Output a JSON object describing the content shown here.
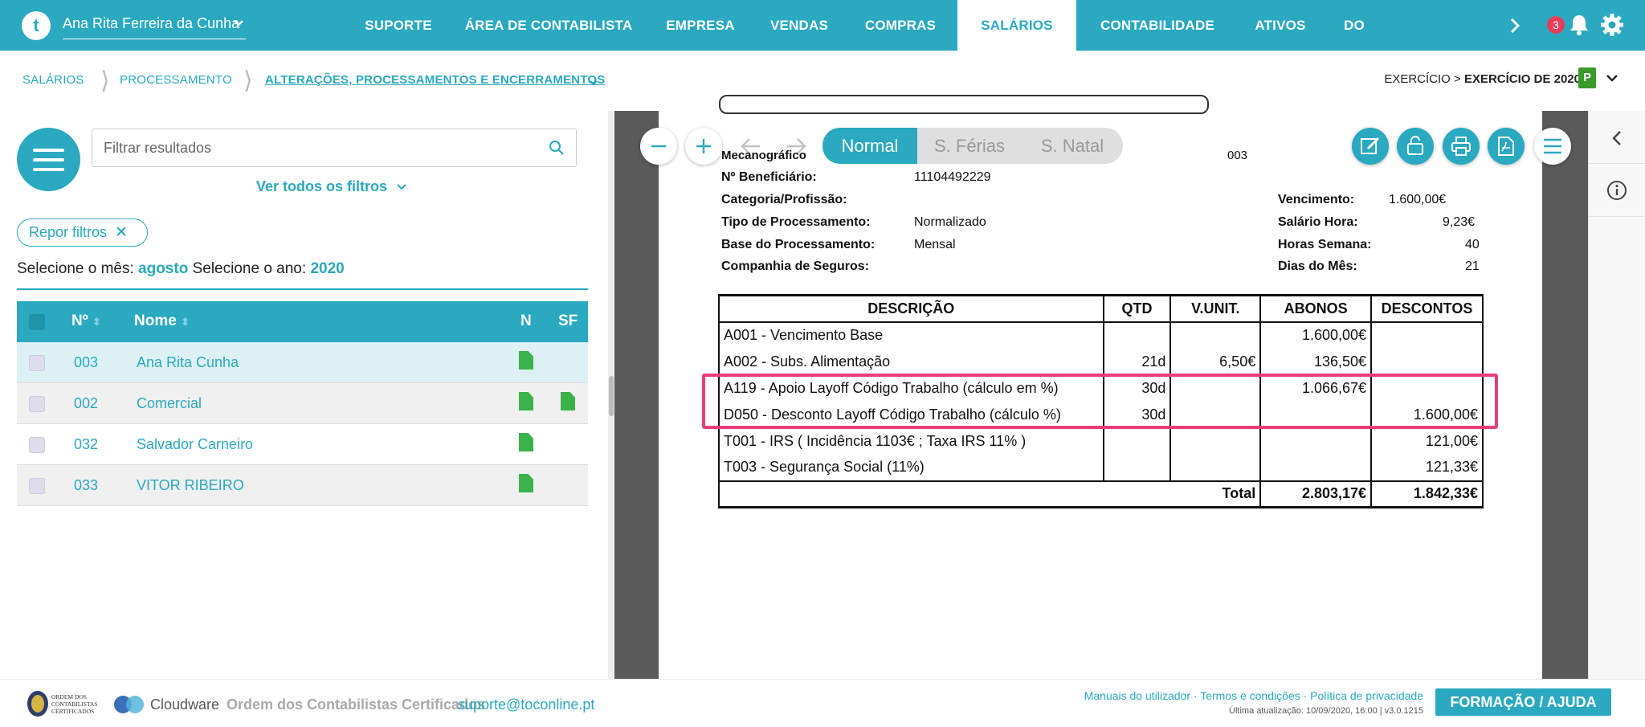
{
  "header": {
    "logo_letter": "t",
    "user_name": "Ana Rita Ferreira da Cunha",
    "nav": [
      "SUPORTE",
      "ÁREA DE CONTABILISTA",
      "EMPRESA",
      "VENDAS",
      "COMPRAS",
      "SALÁRIOS",
      "CONTABILIDADE",
      "ATIVOS",
      "DO"
    ],
    "active_nav": "SALÁRIOS",
    "notifications_count": "3"
  },
  "breadcrumb": {
    "items": [
      "SALÁRIOS",
      "PROCESSAMENTO",
      "ALTERAÇÕES, PROCESSAMENTOS E ENCERRAMENTOS"
    ],
    "exercise_prefix": "EXERCÍCIO >",
    "exercise_value": "EXERCÍCIO DE 2020",
    "exercise_badge": "P"
  },
  "left": {
    "filter_placeholder": "Filtrar resultados",
    "all_filters": "Ver todos os filtros",
    "reset_filters": "Repor filtros",
    "month_label": "Selecione o mês:",
    "month_value": "agosto",
    "year_label": "Selecione o ano:",
    "year_value": "2020",
    "columns": {
      "num": "Nº",
      "name": "Nome",
      "n": "N",
      "sf": "SF"
    },
    "rows": [
      {
        "num": "003",
        "name": "Ana Rita Cunha",
        "n": true,
        "sf": false
      },
      {
        "num": "002",
        "name": "Comercial",
        "n": true,
        "sf": true
      },
      {
        "num": "032",
        "name": "Salvador Carneiro",
        "n": true,
        "sf": false
      },
      {
        "num": "033",
        "name": "VITOR RIBEIRO",
        "n": true,
        "sf": false
      }
    ]
  },
  "viewer": {
    "tabs": [
      "Normal",
      "S. Férias",
      "S. Natal"
    ],
    "active_tab": "Normal",
    "info": {
      "mecanografico_label": "Mecanográfico",
      "mecanografico_value": "003",
      "beneficiario_label": "Nº Beneficiário:",
      "beneficiario_value": "11104492229",
      "categoria_label": "Categoria/Profissão:",
      "tipo_label": "Tipo de Processamento:",
      "tipo_value": "Normalizado",
      "base_label": "Base do Processamento:",
      "base_value": "Mensal",
      "seguros_label": "Companhia de Seguros:",
      "vencimento_label": "Vencimento:",
      "vencimento_value": "1.600,00€",
      "salario_hora_label": "Salário Hora:",
      "salario_hora_value": "9,23€",
      "horas_semana_label": "Horas Semana:",
      "horas_semana_value": "40",
      "dias_mes_label": "Dias do Mês:",
      "dias_mes_value": "21"
    },
    "table": {
      "headers": [
        "DESCRIÇÃO",
        "QTD",
        "V.UNIT.",
        "ABONOS",
        "DESCONTOS"
      ],
      "rows": [
        {
          "desc": "A001 - Vencimento Base",
          "qtd": "",
          "unit": "",
          "abonos": "1.600,00€",
          "descontos": ""
        },
        {
          "desc": "A002 - Subs. Alimentação",
          "qtd": "21d",
          "unit": "6,50€",
          "abonos": "136,50€",
          "descontos": ""
        },
        {
          "desc": "A119 - Apoio Layoff Código Trabalho (cálculo em %)",
          "qtd": "30d",
          "unit": "",
          "abonos": "1.066,67€",
          "descontos": ""
        },
        {
          "desc": "D050 - Desconto Layoff Código Trabalho (cálculo %)",
          "qtd": "30d",
          "unit": "",
          "abonos": "",
          "descontos": "1.600,00€"
        },
        {
          "desc": "T001 - IRS ( Incidência 1103€ ; Taxa IRS 11% )",
          "qtd": "",
          "unit": "",
          "abonos": "",
          "descontos": "121,00€"
        },
        {
          "desc": "T003 - Segurança Social (11%)",
          "qtd": "",
          "unit": "",
          "abonos": "",
          "descontos": "121,33€"
        }
      ],
      "total_label": "Total",
      "total_abonos": "2.803,17€",
      "total_descontos": "1.842,33€"
    }
  },
  "footer": {
    "org": "Ordem dos Contabilistas Certificados",
    "email": "suporte@toconline.pt",
    "cloudware": "Cloudware",
    "logo_text": "ORDEM DOS CONTABILISTAS CERTIFICADOS",
    "links": "Manuais do utilizador · Termos e condições · Política de privacidade",
    "updated": "Última atualização: 10/09/2020, 16:00 | v3.0.1215",
    "help_button": "FORMAÇÃO / AJUDA"
  },
  "colors": {
    "accent": "#2aa9c0",
    "highlight": "#e83e75",
    "doc_icon": "#3bb24a"
  }
}
